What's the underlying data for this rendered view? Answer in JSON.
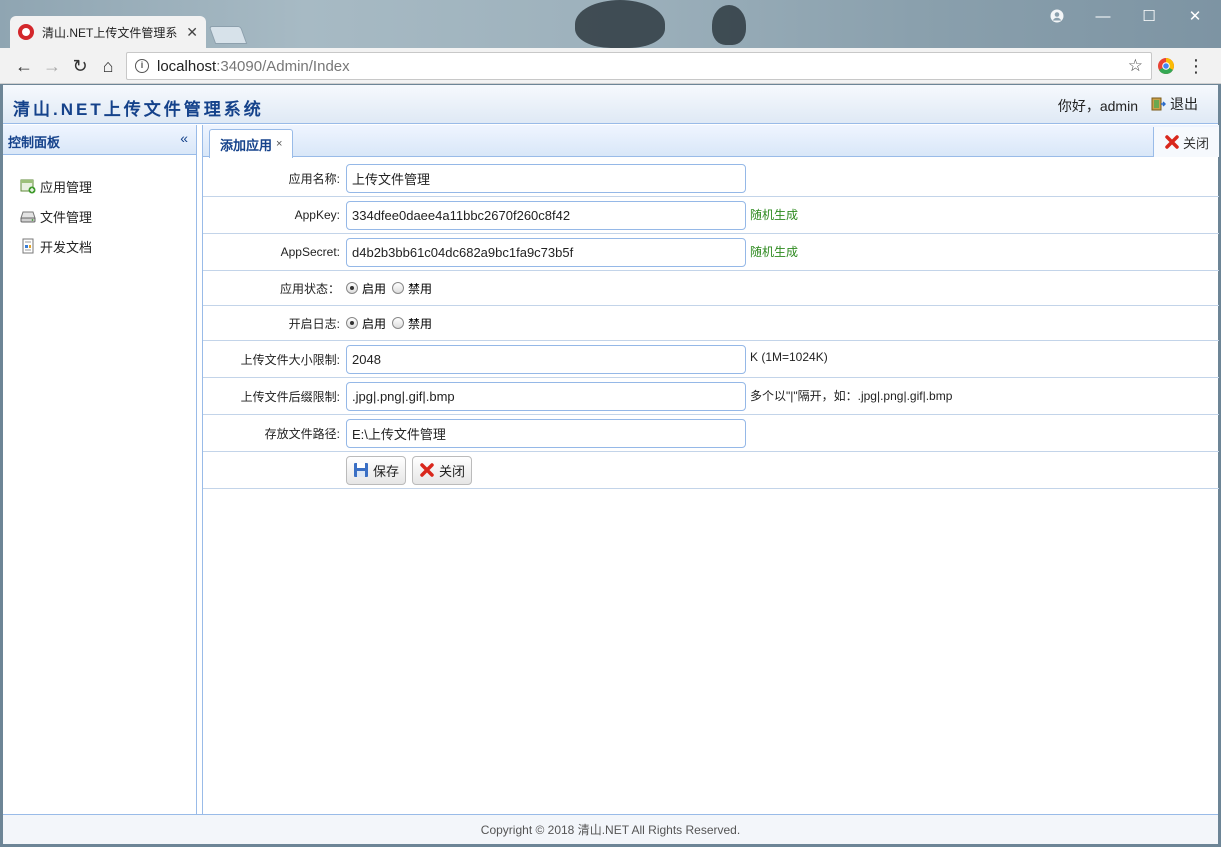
{
  "browser": {
    "tab_title": "清山.NET上传文件管理系",
    "url_host": "localhost",
    "url_rest": ":34090/Admin/Index"
  },
  "app": {
    "title": "清山.NET上传文件管理系统",
    "greeting": "你好，admin",
    "logout_label": "退出"
  },
  "sidebar": {
    "header": "控制面板",
    "items": [
      {
        "label": "应用管理",
        "icon": "app-add-icon"
      },
      {
        "label": "文件管理",
        "icon": "drive-icon"
      },
      {
        "label": "开发文档",
        "icon": "document-icon"
      }
    ]
  },
  "main": {
    "tab_label": "添加应用",
    "close_tab_label": "关闭"
  },
  "form": {
    "app_name_label": "应用名称:",
    "app_name_value": "上传文件管理",
    "appkey_label": "AppKey:",
    "appkey_value": "334dfee0daee4a11bbc2670f260c8f42",
    "appkey_hint": "随机生成",
    "appsecret_label": "AppSecret:",
    "appsecret_value": "d4b2b3bb61c04dc682a9bc1fa9c73b5f",
    "appsecret_hint": "随机生成",
    "status_label": "应用状态：",
    "status_on": "启用",
    "status_off": "禁用",
    "log_label": "开启日志:",
    "log_on": "启用",
    "log_off": "禁用",
    "size_label": "上传文件大小限制:",
    "size_value": "2048",
    "size_hint": "K (1M=1024K)",
    "ext_label": "上传文件后缀限制:",
    "ext_value": ".jpg|.png|.gif|.bmp",
    "ext_hint": "多个以\"|\"隔开，如：.jpg|.png|.gif|.bmp",
    "path_label": "存放文件路径:",
    "path_value": "E:\\上传文件管理",
    "save_label": "保存",
    "close_label": "关闭"
  },
  "footer": {
    "copyright": "Copyright © 2018 清山.NET All Rights Reserved."
  },
  "colors": {
    "accent": "#15428b",
    "border": "#99bbe8",
    "hint_green": "#2d8a1f"
  }
}
